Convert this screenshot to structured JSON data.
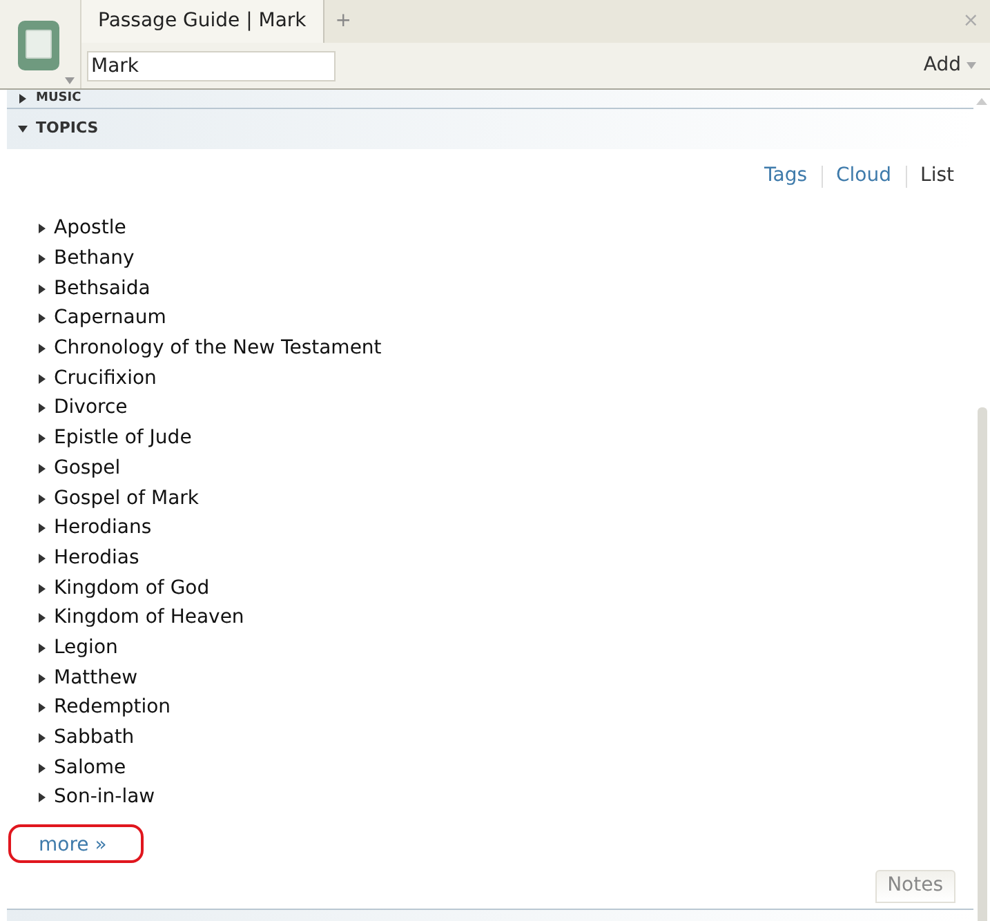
{
  "tab": {
    "title": "Passage Guide | Mark",
    "add_tab": "+",
    "close": "×"
  },
  "toolbar": {
    "reference": "Mark",
    "add_menu": "Add"
  },
  "sections": [
    {
      "title": "MUSIC",
      "expanded": false
    },
    {
      "title": "TOPICS",
      "expanded": true
    }
  ],
  "view_modes": [
    {
      "label": "Tags",
      "selected": false
    },
    {
      "label": "Cloud",
      "selected": false
    },
    {
      "label": "List",
      "selected": true
    }
  ],
  "topics": [
    {
      "label": "Apostle"
    },
    {
      "label": "Bethany"
    },
    {
      "label": "Bethsaida"
    },
    {
      "label": "Capernaum"
    },
    {
      "label": "Chronology of the New Testament"
    },
    {
      "label": "Crucifixion"
    },
    {
      "label": "Divorce"
    },
    {
      "label": "Epistle of Jude"
    },
    {
      "label": "Gospel"
    },
    {
      "label": "Gospel of Mark"
    },
    {
      "label": "Herodians"
    },
    {
      "label": "Herodias"
    },
    {
      "label": "Kingdom of God"
    },
    {
      "label": "Kingdom of Heaven"
    },
    {
      "label": "Legion"
    },
    {
      "label": "Matthew"
    },
    {
      "label": "Redemption"
    },
    {
      "label": "Sabbath"
    },
    {
      "label": "Salome"
    },
    {
      "label": "Son-in-law"
    }
  ],
  "more_link": {
    "label": "more »",
    "highlighted": true
  },
  "notes_button": "Notes"
}
